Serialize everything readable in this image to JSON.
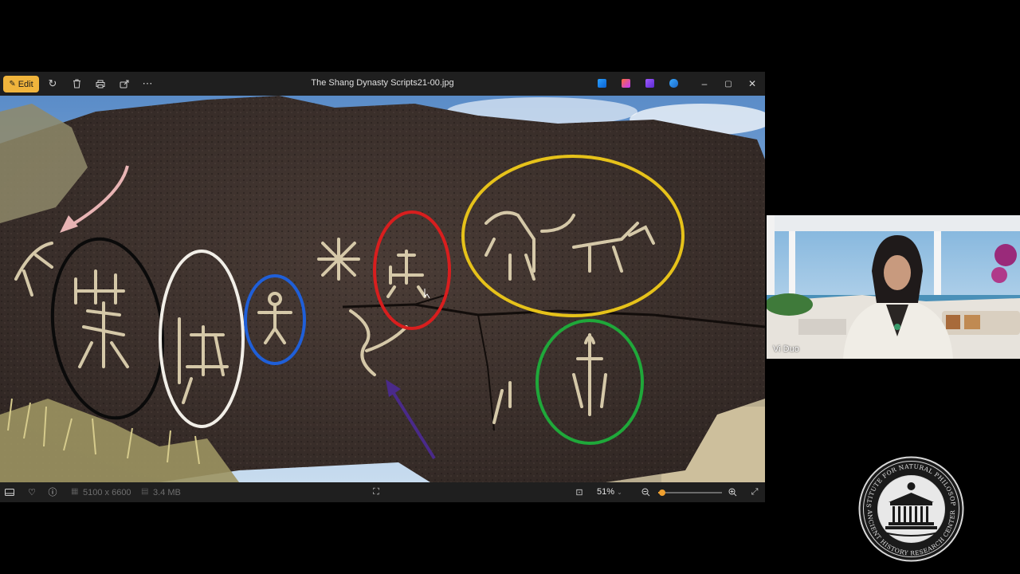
{
  "viewer": {
    "title": "The Shang Dynasty Scripts21-00.jpg",
    "toolbar": {
      "edit_label": "Edit",
      "icons": [
        "edit-icon",
        "rotate-icon",
        "delete-icon",
        "print-icon",
        "share-icon",
        "more-icon"
      ]
    },
    "app_icons": [
      "photos-app-icon",
      "paint-app-icon",
      "clipchamp-app-icon",
      "onedrive-app-icon"
    ],
    "window_controls": [
      "minimize-icon",
      "maximize-icon",
      "close-icon"
    ],
    "status": {
      "dimensions": "5100 x 6600",
      "file_size": "3.4 MB",
      "zoom": "51%",
      "zoom_fraction": 0.06
    },
    "photo": {
      "description_colors": {
        "black_circle": "#0a0a0a",
        "white_circle": "#f2efe8",
        "blue_circle": "#1f5fd8",
        "red_circle": "#d81e1e",
        "yellow_circle": "#e6c21a",
        "green_circle": "#1fa83a",
        "pink_arrow": "#e8b4b4",
        "purple_arrow": "#4a2a8a"
      }
    }
  },
  "video": {
    "participant_name": "Vi Duo"
  },
  "seal": {
    "text_top": "INSTITUTE FOR NATURAL PHILOSOPHY",
    "text_bottom": "ANCIENT HISTORY RESEARCH CENTER"
  }
}
